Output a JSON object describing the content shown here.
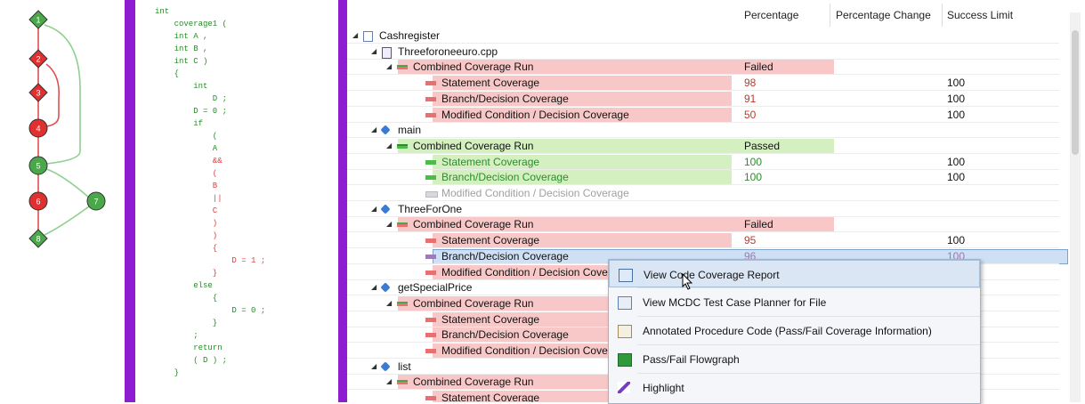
{
  "flowgraph": {
    "nodes": [
      {
        "label": "1",
        "color": "#4aa84a",
        "shape": "diamond"
      },
      {
        "label": "2",
        "color": "#e03030",
        "shape": "diamond"
      },
      {
        "label": "3",
        "color": "#e03030",
        "shape": "diamond"
      },
      {
        "label": "4",
        "color": "#e03030",
        "shape": "circle"
      },
      {
        "label": "5",
        "color": "#4aa84a",
        "shape": "circle"
      },
      {
        "label": "6",
        "color": "#e03030",
        "shape": "circle"
      },
      {
        "label": "7",
        "color": "#4aa84a",
        "shape": "circle"
      },
      {
        "label": "8",
        "color": "#4aa84a",
        "shape": "diamond"
      }
    ]
  },
  "code": {
    "lines": [
      {
        "text": "int",
        "color": "#2a8a2a"
      },
      {
        "text": "    coverage1 (",
        "color": "#2a8a2a"
      },
      {
        "text": "    int A ,",
        "color": "#2a8a2a"
      },
      {
        "text": "    int B ,",
        "color": "#2a8a2a"
      },
      {
        "text": "    int C )",
        "color": "#2a8a2a"
      },
      {
        "text": "    {",
        "color": "#2a8a2a"
      },
      {
        "text": "        int",
        "color": "#2a8a2a"
      },
      {
        "text": "            D ;",
        "color": "#2a8a2a"
      },
      {
        "text": "        D = 0 ;",
        "color": "#2a8a2a"
      },
      {
        "text": "        if",
        "color": "#2a8a2a"
      },
      {
        "text": "            (",
        "color": "#2a8a2a"
      },
      {
        "text": "            A",
        "color": "#2a8a2a"
      },
      {
        "text": "            &&",
        "color": "#e04040"
      },
      {
        "text": "            (",
        "color": "#e04040"
      },
      {
        "text": "            B",
        "color": "#e04040"
      },
      {
        "text": "            ||",
        "color": "#e04040"
      },
      {
        "text": "            C",
        "color": "#e04040"
      },
      {
        "text": "            )",
        "color": "#e04040"
      },
      {
        "text": "            )",
        "color": "#e04040"
      },
      {
        "text": "            {",
        "color": "#e04040"
      },
      {
        "text": "                D = 1 ;",
        "color": "#e04040"
      },
      {
        "text": "            }",
        "color": "#e04040"
      },
      {
        "text": "        else",
        "color": "#2a8a2a"
      },
      {
        "text": "            {",
        "color": "#2a8a2a"
      },
      {
        "text": "                D = 0 ;",
        "color": "#2a8a2a"
      },
      {
        "text": "            }",
        "color": "#2a8a2a"
      },
      {
        "text": "        ;",
        "color": "#2a8a2a"
      },
      {
        "text": "        return",
        "color": "#2a8a2a"
      },
      {
        "text": "        ( D ) ;",
        "color": "#2a8a2a"
      },
      {
        "text": "    }",
        "color": "#2a8a2a"
      }
    ]
  },
  "tree": {
    "columns": {
      "percentage": "Percentage",
      "percentage_change": "Percentage Change",
      "success_limit": "Success Limit"
    },
    "rows": [
      {
        "label": "Cashregister",
        "indent": 0,
        "icon": "project-icon",
        "pct": "",
        "limit": "",
        "state": "none",
        "expand": true
      },
      {
        "label": "Threeforoneeuro.cpp",
        "indent": 1,
        "icon": "file-icon",
        "pct": "",
        "limit": "",
        "state": "none",
        "expand": true
      },
      {
        "label": "Combined Coverage Run",
        "indent": 2,
        "icon": "coverage-run-icon",
        "pct": "Failed",
        "limit": "",
        "state": "fail",
        "expand": true
      },
      {
        "label": "Statement Coverage",
        "indent": 3,
        "icon": "coverage-bar-icon",
        "pct": "98",
        "limit": "100",
        "state": "fail",
        "expand": false
      },
      {
        "label": "Branch/Decision Coverage",
        "indent": 3,
        "icon": "coverage-bar-icon",
        "pct": "91",
        "limit": "100",
        "state": "fail",
        "expand": false
      },
      {
        "label": "Modified Condition / Decision Coverage",
        "indent": 3,
        "icon": "coverage-bar-icon",
        "pct": "50",
        "limit": "100",
        "state": "fail",
        "expand": false
      },
      {
        "label": "main",
        "indent": 1,
        "icon": "function-icon",
        "pct": "",
        "limit": "",
        "state": "none",
        "expand": true
      },
      {
        "label": "Combined Coverage Run",
        "indent": 2,
        "icon": "coverage-run-icon",
        "pct": "Passed",
        "limit": "",
        "state": "pass",
        "expand": true
      },
      {
        "label": "Statement Coverage",
        "indent": 3,
        "icon": "coverage-bar-icon",
        "pct": "100",
        "limit": "100",
        "state": "pass",
        "expand": false
      },
      {
        "label": "Branch/Decision Coverage",
        "indent": 3,
        "icon": "coverage-bar-icon",
        "pct": "100",
        "limit": "100",
        "state": "pass",
        "expand": false
      },
      {
        "label": "Modified Condition / Decision Coverage",
        "indent": 3,
        "icon": "coverage-bar-icon",
        "pct": "",
        "limit": "",
        "state": "disabled",
        "expand": false
      },
      {
        "label": "ThreeForOne",
        "indent": 1,
        "icon": "function-icon",
        "pct": "",
        "limit": "",
        "state": "none",
        "expand": true
      },
      {
        "label": "Combined Coverage Run",
        "indent": 2,
        "icon": "coverage-run-icon",
        "pct": "Failed",
        "limit": "",
        "state": "fail",
        "expand": true
      },
      {
        "label": "Statement Coverage",
        "indent": 3,
        "icon": "coverage-bar-icon",
        "pct": "95",
        "limit": "100",
        "state": "fail",
        "expand": false
      },
      {
        "label": "Branch/Decision Coverage",
        "indent": 3,
        "icon": "coverage-bar-icon",
        "pct": "96",
        "limit": "100",
        "state": "selected",
        "expand": false
      },
      {
        "label": "Modified Condition / Decision Coverage",
        "indent": 3,
        "icon": "coverage-bar-icon",
        "pct": "",
        "limit": "",
        "state": "fail",
        "expand": false
      },
      {
        "label": "getSpecialPrice",
        "indent": 1,
        "icon": "function-icon",
        "pct": "",
        "limit": "",
        "state": "none",
        "expand": true
      },
      {
        "label": "Combined Coverage Run",
        "indent": 2,
        "icon": "coverage-run-icon",
        "pct": "",
        "limit": "",
        "state": "fail",
        "expand": true
      },
      {
        "label": "Statement Coverage",
        "indent": 3,
        "icon": "coverage-bar-icon",
        "pct": "",
        "limit": "",
        "state": "fail",
        "expand": false
      },
      {
        "label": "Branch/Decision Coverage",
        "indent": 3,
        "icon": "coverage-bar-icon",
        "pct": "",
        "limit": "",
        "state": "fail",
        "expand": false
      },
      {
        "label": "Modified Condition / Decision Coverage",
        "indent": 3,
        "icon": "coverage-bar-icon",
        "pct": "",
        "limit": "",
        "state": "fail",
        "expand": false
      },
      {
        "label": "list",
        "indent": 1,
        "icon": "function-icon",
        "pct": "",
        "limit": "",
        "state": "none",
        "expand": true
      },
      {
        "label": "Combined Coverage Run",
        "indent": 2,
        "icon": "coverage-run-icon",
        "pct": "",
        "limit": "",
        "state": "fail",
        "expand": true
      },
      {
        "label": "Statement Coverage",
        "indent": 3,
        "icon": "coverage-bar-icon",
        "pct": "",
        "limit": "",
        "state": "fail",
        "expand": false
      }
    ]
  },
  "context_menu": {
    "items": [
      {
        "label": "View Code Coverage Report",
        "icon": "report-icon",
        "hover": true
      },
      {
        "label": "View MCDC Test Case Planner for File",
        "icon": "planner-icon",
        "hover": false
      },
      {
        "label": "Annotated Procedure Code (Pass/Fail Coverage Information)",
        "icon": "annotated-code-icon",
        "hover": false
      },
      {
        "label": "Pass/Fail Flowgraph",
        "icon": "flowgraph-icon",
        "hover": false
      },
      {
        "label": "Highlight",
        "icon": "highlight-pen-icon",
        "hover": false
      }
    ]
  },
  "colors": {
    "fail": "#f8c8c8",
    "pass": "#d4f0c0",
    "fail_text": "#c0392b",
    "pass_text": "#2e8b2e",
    "selected": "#cfe0f5",
    "fail_bar": "#e87070",
    "pass_bar": "#4cbb4c"
  }
}
